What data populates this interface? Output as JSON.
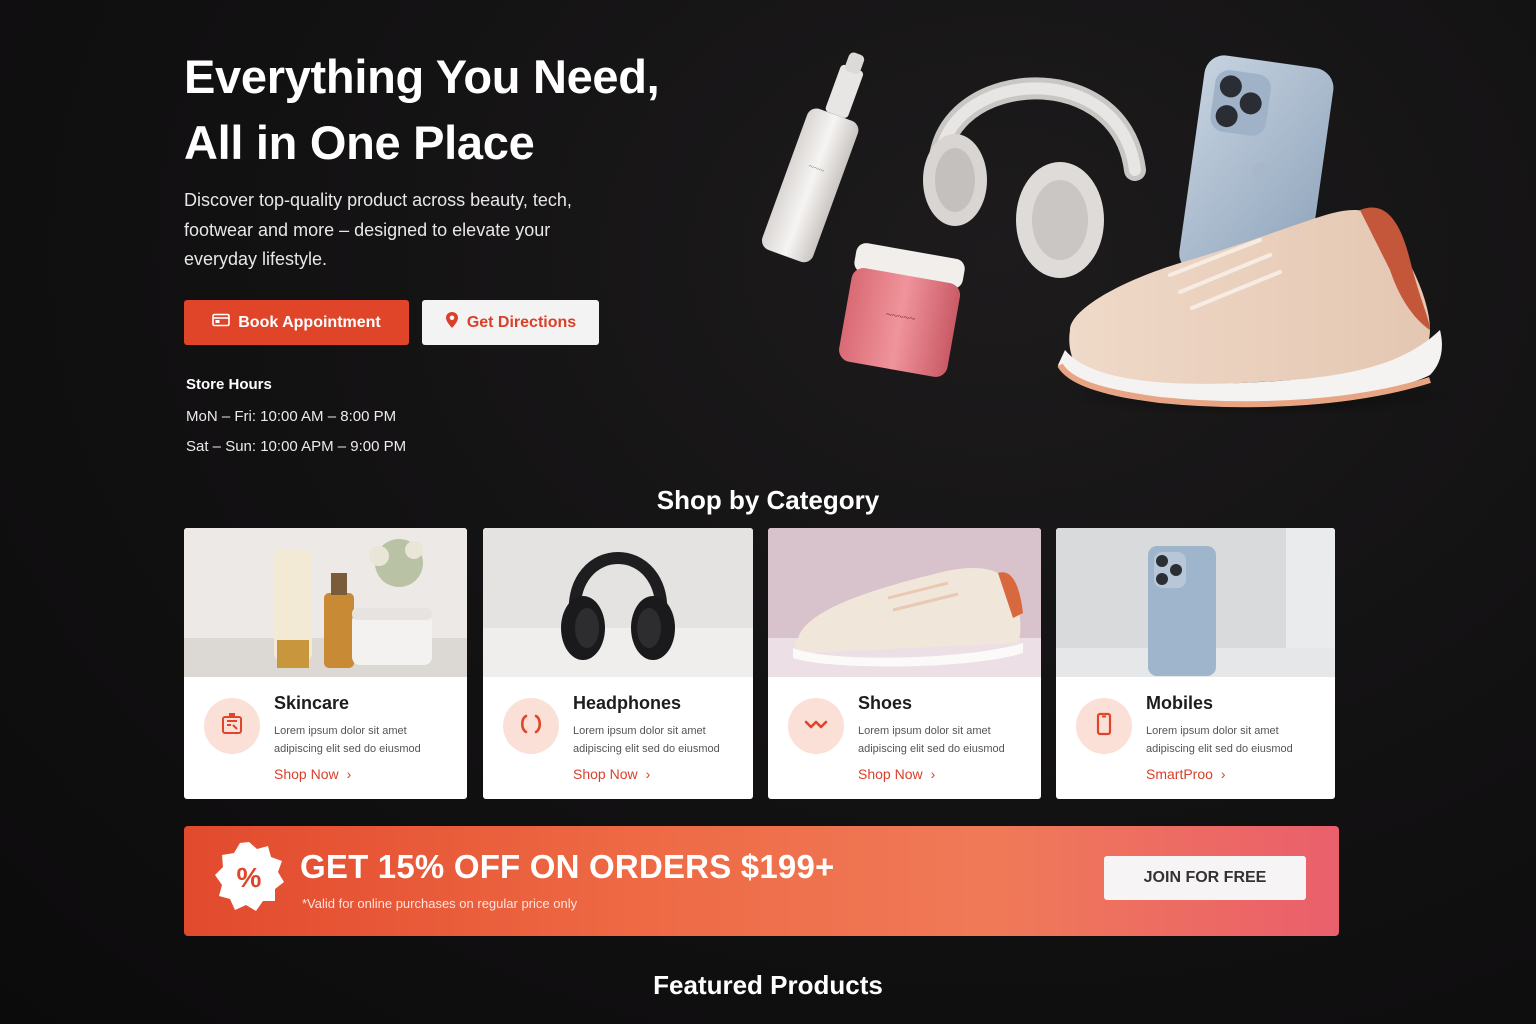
{
  "hero": {
    "title_line1": "Everything You Need,",
    "title_line2": "All in One Place",
    "subtitle": "Discover top-quality product across beauty, tech, footwear and more – designed to elevate your everyday lifestyle.",
    "book_label": "Book Appointment",
    "directions_label": "Get Directions",
    "hours_title": "Store Hours",
    "hours_weekday": "MoN – Fri: 10:00 AM – 8:00 PM",
    "hours_weekend": "Sat – Sun: 10:00 APM – 9:00 PM"
  },
  "categories_title": "Shop by Category",
  "categories": [
    {
      "name": "Skincare",
      "desc": "Lorem ipsum dolor sit amet adipiscing elit sed do eiusmod",
      "link": "Shop Now",
      "icon": "skincare-icon"
    },
    {
      "name": "Headphones",
      "desc": "Lorem ipsum dolor sit amet adipiscing elit sed do eiusmod",
      "link": "Shop Now",
      "icon": "headphones-icon"
    },
    {
      "name": "Shoes",
      "desc": "Lorem ipsum dolor sit amet adipiscing elit sed do eiusmod",
      "link": "Shop Now",
      "icon": "shoes-icon"
    },
    {
      "name": "Mobiles",
      "desc": "Lorem ipsum dolor sit amet adipiscing elit sed do eiusmod",
      "link": "SmartProo",
      "icon": "mobile-icon"
    }
  ],
  "promo": {
    "headline": "GET 15% OFF ON ORDERS $199+",
    "note": "*Valid for online purchases on regular price only",
    "button": "JOIN FOR FREE"
  },
  "featured_title": "Featured Products",
  "colors": {
    "accent": "#e0452a",
    "background": "#121112",
    "icon_bg": "#fbe0d8"
  }
}
